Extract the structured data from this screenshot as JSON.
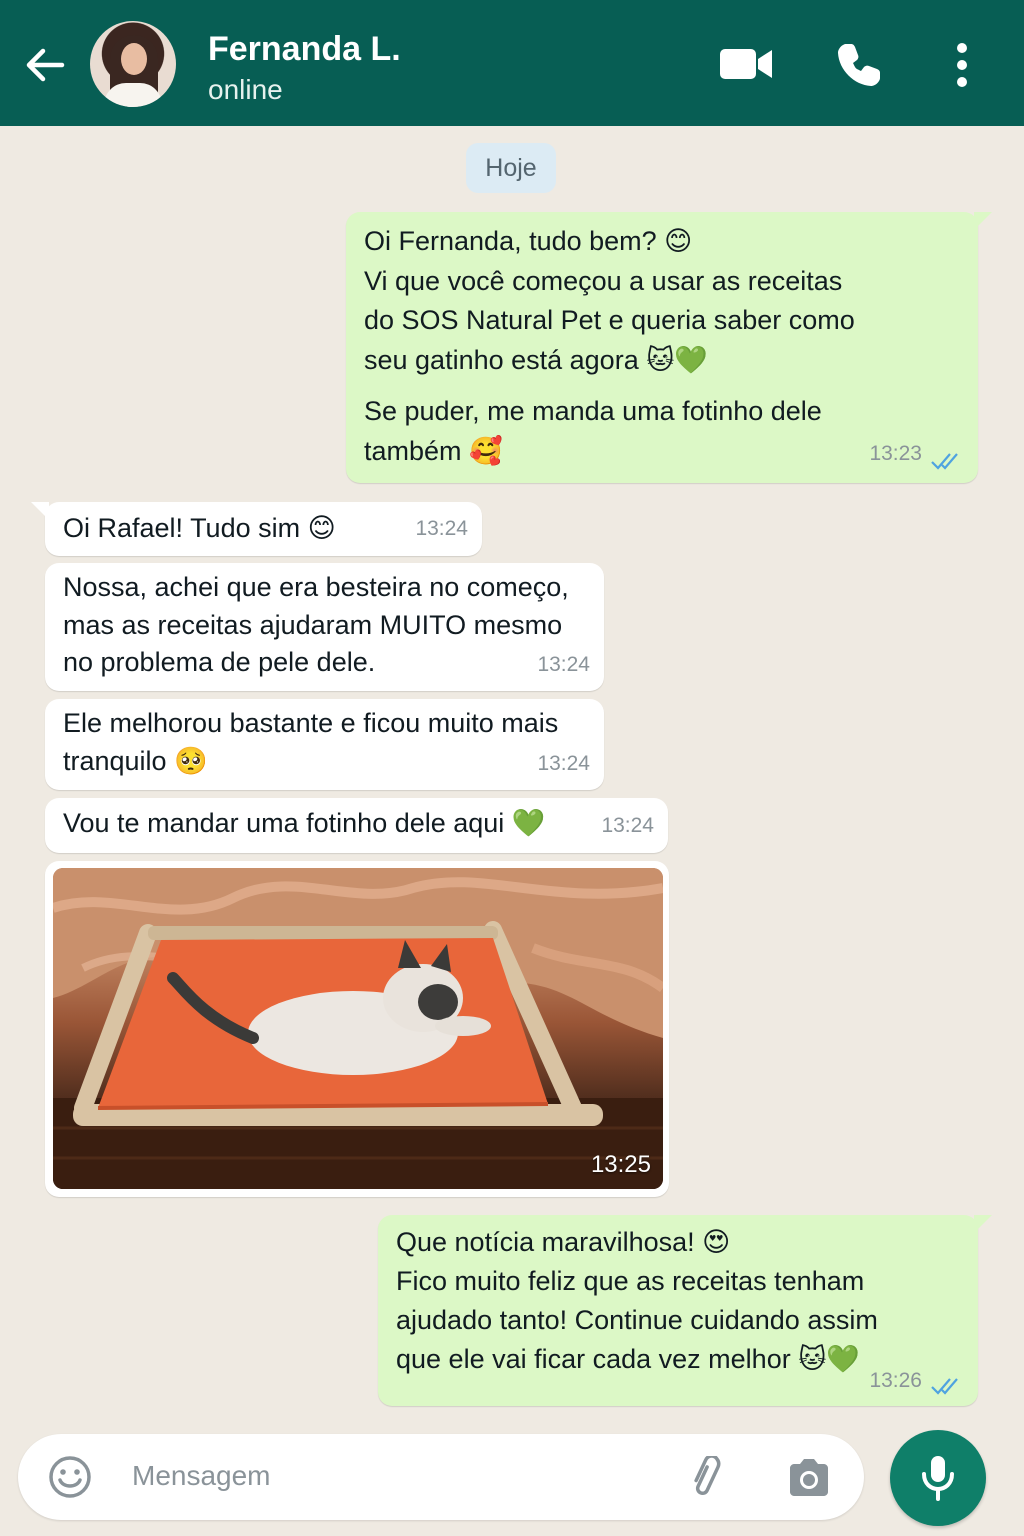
{
  "header": {
    "contact_name": "Fernanda L.",
    "status": "online",
    "icons": [
      "back-arrow-icon",
      "video-call-icon",
      "phone-icon",
      "more-options-icon"
    ],
    "color": "#075e54"
  },
  "date_chip": "Hoje",
  "messages": [
    {
      "direction": "outgoing",
      "lines": [
        "Oi Fernanda, tudo bem? 😊",
        "Vi que você começou a usar as receitas",
        "do SOS Natural Pet e queria saber como",
        "seu gatinho está agora 🐱💚"
      ],
      "lines2": [
        "Se puder, me manda uma fotinho dele",
        "também 🥰"
      ],
      "time": "13:23",
      "status": "read"
    },
    {
      "direction": "incoming",
      "lines": [
        "Oi Rafael! Tudo sim 😊"
      ],
      "time": "13:24"
    },
    {
      "direction": "incoming",
      "lines": [
        "Nossa, achei que era besteira no começo,",
        "mas as receitas ajudaram MUITO mesmo",
        "no problema de pele dele."
      ],
      "time": "13:24"
    },
    {
      "direction": "incoming",
      "lines": [
        "Ele melhorou bastante e ficou muito mais",
        "tranquilo 🥺"
      ],
      "time": "13:24"
    },
    {
      "direction": "incoming",
      "lines": [
        "Vou te mandar uma fotinho dele aqui 💚"
      ],
      "time": "13:24"
    },
    {
      "direction": "incoming",
      "type": "photo",
      "time": "13:25"
    },
    {
      "direction": "outgoing",
      "lines": [
        "Que notícia maravilhosa! 😍",
        "Fico muito feliz que as receitas tenham",
        "ajudado tanto! Continue cuidando assim",
        "que ele vai ficar cada vez melhor 🐱💚"
      ],
      "time": "13:26",
      "status": "read"
    }
  ],
  "input": {
    "placeholder": "Mensagem",
    "icons": [
      "emoji-icon",
      "attach-icon",
      "camera-icon",
      "microphone-icon"
    ]
  },
  "colors": {
    "outgoing_bubble": "#dcf8c6",
    "incoming_bubble": "#ffffff",
    "background": "#efeae2",
    "read_ticks": "#4fa3e0",
    "mic_button": "#0f7f69"
  }
}
